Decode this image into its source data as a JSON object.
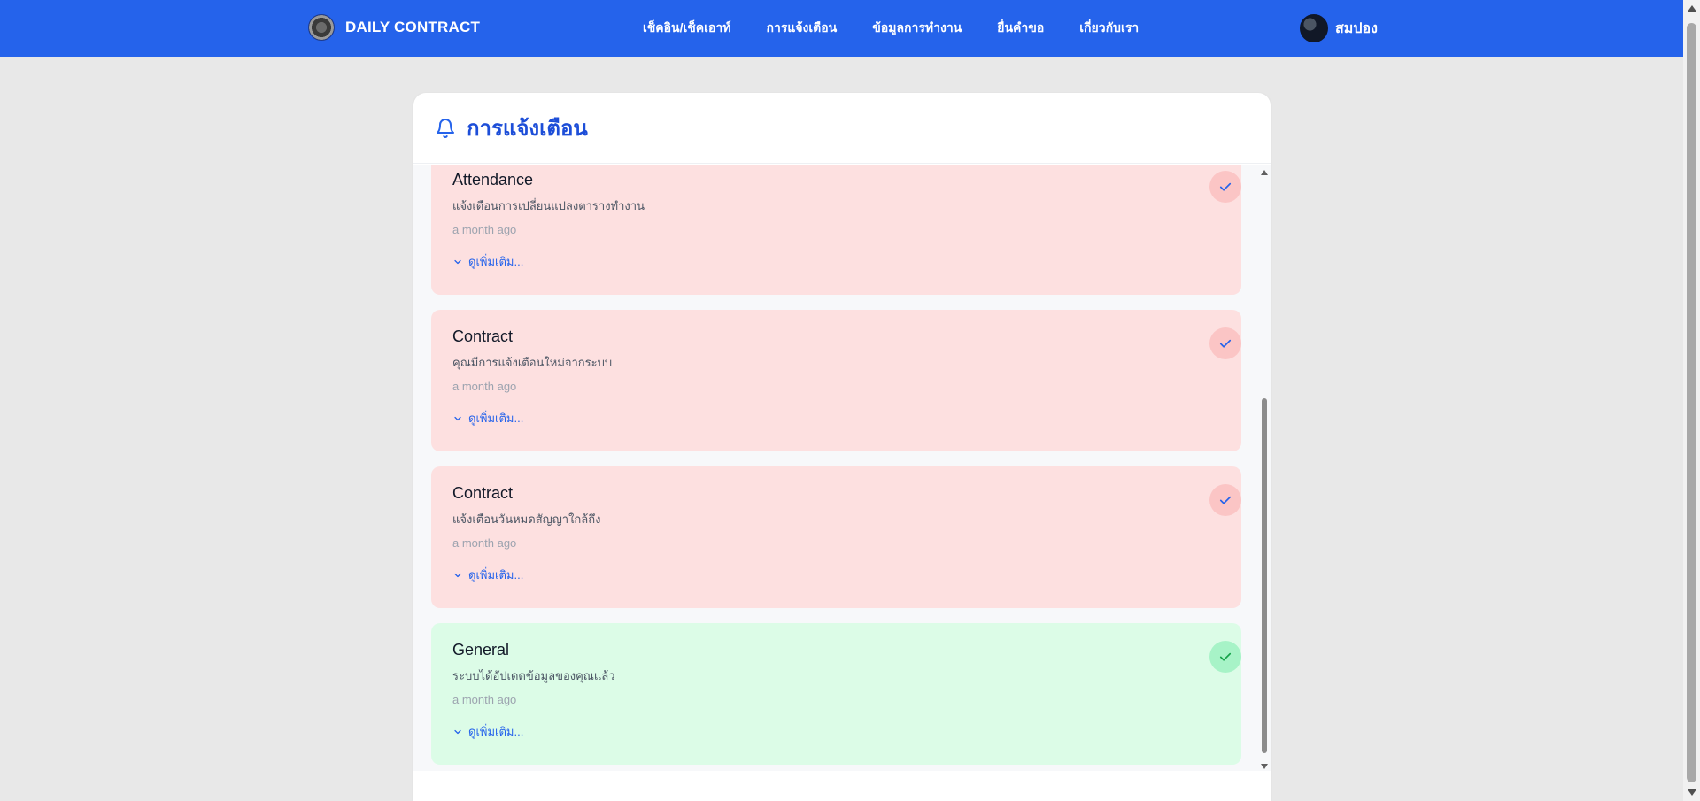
{
  "brand": {
    "name": "DAILY CONTRACT"
  },
  "nav": {
    "links": [
      "เช็คอิน/เช็คเอาท์",
      "การแจ้งเตือน",
      "ข้อมูลการทำงาน",
      "ยื่นคำขอ",
      "เกี่ยวกับเรา"
    ]
  },
  "user": {
    "name": "สมปอง"
  },
  "page": {
    "title": "การแจ้งเตือน"
  },
  "notifications": [
    {
      "category": "Attendance",
      "message": "แจ้งเตือนการเปลี่ยนแปลงตารางทำงาน",
      "time": "a month ago",
      "more_label": "ดูเพิ่มเติม...",
      "status": "red"
    },
    {
      "category": "Contract",
      "message": "คุณมีการแจ้งเตือนใหม่จากระบบ",
      "time": "a month ago",
      "more_label": "ดูเพิ่มเติม...",
      "status": "red"
    },
    {
      "category": "Contract",
      "message": "แจ้งเตือนวันหมดสัญญาใกล้ถึง",
      "time": "a month ago",
      "more_label": "ดูเพิ่มเติม...",
      "status": "red"
    },
    {
      "category": "General",
      "message": "ระบบได้อัปเดตข้อมูลของคุณแล้ว",
      "time": "a month ago",
      "more_label": "ดูเพิ่มเติม...",
      "status": "green"
    }
  ],
  "colors": {
    "nav_bg": "#2563eb",
    "card_red": "#fde0e0",
    "card_green": "#dcfce7",
    "check_red_bg": "#fbc5c5",
    "check_green_bg": "#a7f3c7",
    "accent": "#2563eb"
  },
  "icons": {
    "header": "bell-icon",
    "card_action": "check-icon",
    "more": "chevron-down-icon"
  }
}
